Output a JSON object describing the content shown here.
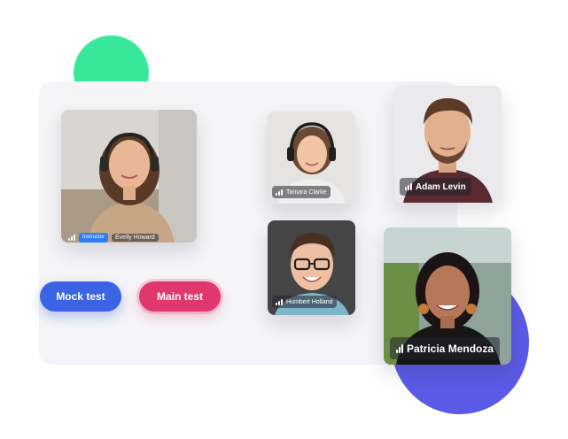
{
  "participants": [
    {
      "name": "Evelly Howard",
      "role": "Instructor"
    },
    {
      "name": "Tamara Clarke"
    },
    {
      "name": "Adam Levin"
    },
    {
      "name": "Humbert Holland"
    },
    {
      "name": "Patricia Mendoza"
    }
  ],
  "buttons": {
    "mock_test": "Mock test",
    "main_test": "Main test"
  },
  "colors": {
    "mock_button": "#3b63e3",
    "main_button": "#e0386e",
    "instructor_badge": "#2f7df6",
    "accent_green": "#37e79a",
    "accent_purple": "#5b5ae6"
  },
  "icons": {
    "audio_level": "signal-bars-icon"
  }
}
